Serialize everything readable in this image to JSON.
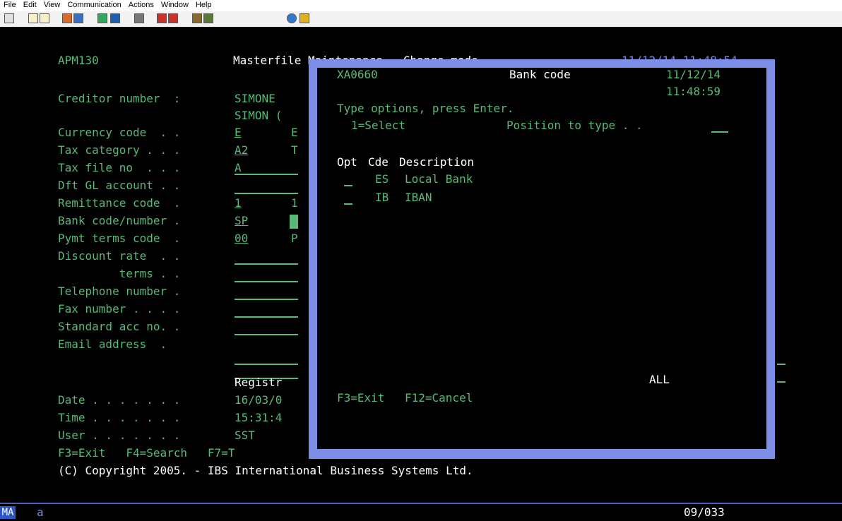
{
  "menu": [
    "File",
    "Edit",
    "View",
    "Communication",
    "Actions",
    "Window",
    "Help"
  ],
  "toolbar_icons": [
    "print-screen-icon",
    "copy-icon",
    "paste-icon",
    "send-file-icon",
    "receive-file-icon",
    "display-icon",
    "color-icon",
    "macro-record-icon",
    "macro-play-icon",
    "macro-stop-icon",
    "map-icon",
    "keyboard-icon",
    "help-icon",
    "stop-icon"
  ],
  "header": {
    "program": "APM130",
    "title": "Masterfile Maintenance - Change mode",
    "datetime": "11/12/14 11:48:54"
  },
  "form": {
    "creditor_label": "Creditor number  : ",
    "creditor_value": "SIMONE",
    "creditor_name": "SIMON (",
    "currency_label": "Currency code  . . ",
    "currency_value": "E",
    "currency_desc": "E",
    "tax_cat_label": "Tax category . . . ",
    "tax_cat_value": "A2",
    "tax_cat_desc": "T",
    "tax_file_label": "Tax file no  . . . ",
    "tax_file_value": "A",
    "dft_gl_label": "Dft GL account . . ",
    "remit_label": "Remittance code  . ",
    "remit_value": "1",
    "remit_desc": "1",
    "bank_label": "Bank code/number . ",
    "bank_value": "SP",
    "pymt_label": "Pymt terms code  . ",
    "pymt_value": "00",
    "pymt_desc": "P",
    "discount_label": "Discount rate  . . ",
    "terms_label": "         terms . . ",
    "telephone_label": "Telephone number . ",
    "fax_label": "Fax number . . . . ",
    "std_acc_label": "Standard acc no. . ",
    "email_label": "Email address  .",
    "registr_label": "Registr",
    "date_label": "Date . . . . . . . ",
    "date_value": "16/03/0",
    "time_label": "Time . . . . . . . ",
    "time_value": "15:31:4",
    "user_label": "User . . . . . . . ",
    "user_value": "SST",
    "fkeys": "F3=Exit   F4=Search   F7=T",
    "copyright": "(C) Copyright 2005. - IBS International Business Systems Ltd."
  },
  "popup": {
    "program": "XA0660",
    "title": "Bank code",
    "date": "11/12/14",
    "time": "11:48:59",
    "instruction": "Type options, press Enter.",
    "option1": "1=Select",
    "position_label": "Position to type . . ",
    "columns": {
      "opt": "Opt",
      "cde": "Cde",
      "desc": "Description"
    },
    "rows": [
      {
        "opt": "",
        "code": "ES",
        "desc": "Local Bank"
      },
      {
        "opt": "",
        "code": "IB",
        "desc": "IBAN"
      }
    ],
    "all_label": "ALL",
    "f3": "F3=Exit",
    "f12": "F12=Cancel"
  },
  "status": {
    "session": "MA",
    "indicator": "a",
    "cursor_pos": "09/033"
  },
  "colors": {
    "green": "#59b978",
    "white": "#ffffff",
    "popup_border": "#7c8ee8",
    "status_line": "#4a61b7"
  }
}
